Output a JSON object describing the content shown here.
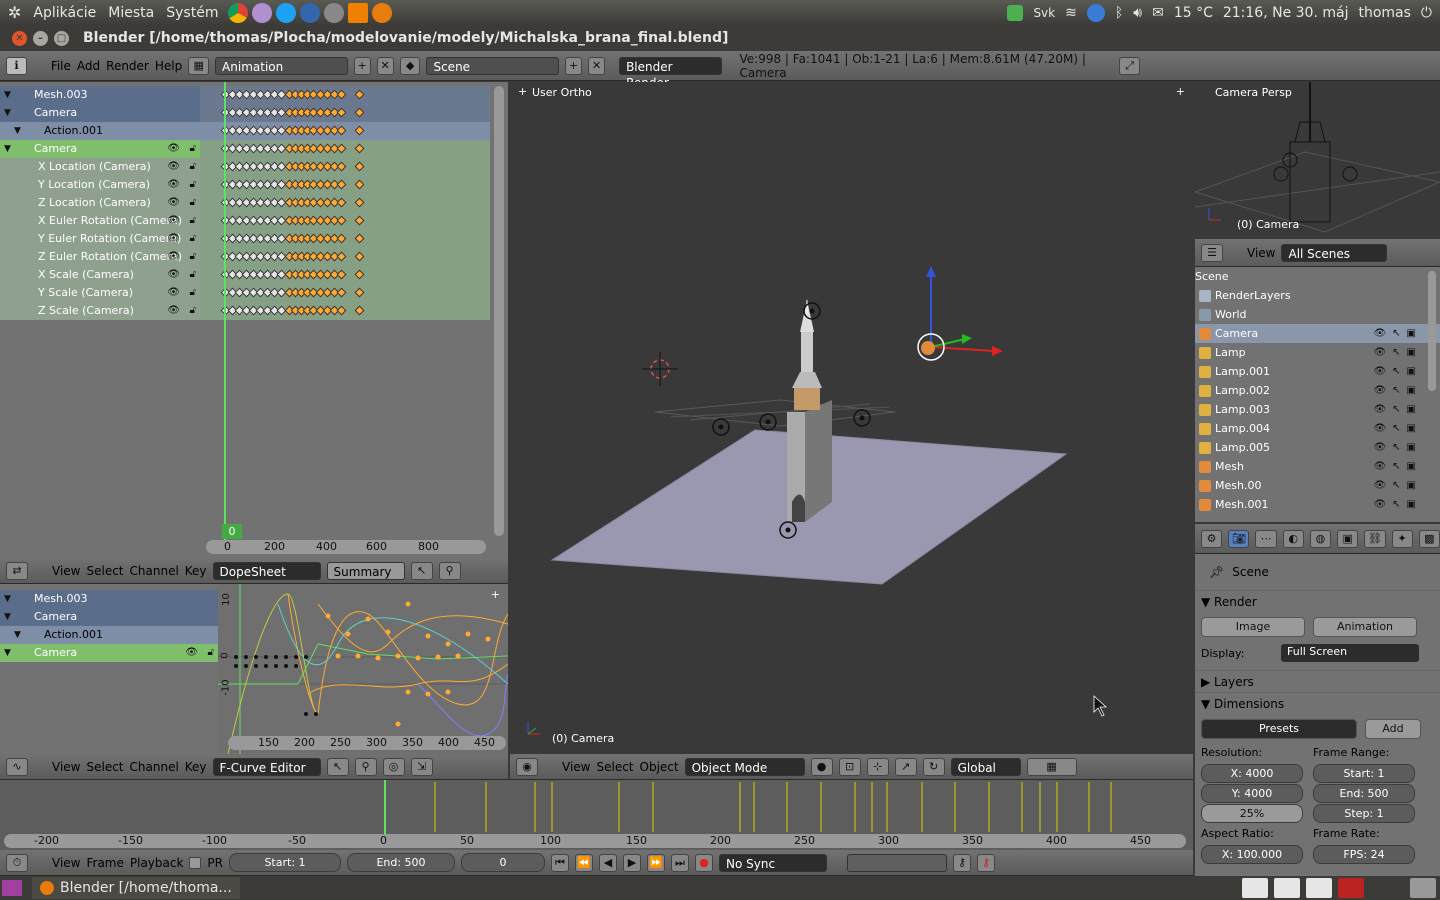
{
  "os_top": {
    "menus": [
      "Aplikácie",
      "Miesta",
      "Systém"
    ],
    "tray": {
      "lang": "Svk",
      "temp": "15 °C",
      "clock": "21:16, Ne 30. máj",
      "user": "thomas"
    }
  },
  "window": {
    "title": "Blender [/home/thomas/Plocha/modelovanie/modely/Michalska_brana_final.blend]"
  },
  "info_header": {
    "menus": [
      "File",
      "Add",
      "Render",
      "Help"
    ],
    "screen": "Animation",
    "scene": "Scene",
    "engine": "Blender Render",
    "stats": "Ve:998 | Fa:1041 | Ob:1-21 | La:6 | Mem:8.61M (47.20M) | Camera"
  },
  "dopesheet": {
    "channels": [
      {
        "label": "Mesh.003",
        "type": "obj"
      },
      {
        "label": "Camera",
        "type": "obj"
      },
      {
        "label": "Action.001",
        "type": "act"
      },
      {
        "label": "Camera",
        "type": "group"
      },
      {
        "label": "X Location (Camera)",
        "type": "ch"
      },
      {
        "label": "Y Location (Camera)",
        "type": "ch"
      },
      {
        "label": "Z Location (Camera)",
        "type": "ch"
      },
      {
        "label": "X Euler Rotation (Camera)",
        "type": "ch"
      },
      {
        "label": "Y Euler Rotation (Camera)",
        "type": "ch"
      },
      {
        "label": "Z Euler Rotation (Camera)",
        "type": "ch"
      },
      {
        "label": "X Scale (Camera)",
        "type": "ch"
      },
      {
        "label": "Y Scale (Camera)",
        "type": "ch"
      },
      {
        "label": "Z Scale (Camera)",
        "type": "ch"
      }
    ],
    "current_frame": "0",
    "ruler": [
      "0",
      "200",
      "400",
      "600",
      "800"
    ],
    "header": {
      "menus": [
        "View",
        "Select",
        "Channel",
        "Key"
      ],
      "mode": "DopeSheet",
      "summary": "Summary"
    }
  },
  "fcurve": {
    "channels": [
      {
        "label": "Mesh.003",
        "type": "obj"
      },
      {
        "label": "Camera",
        "type": "obj"
      },
      {
        "label": "Action.001",
        "type": "act"
      },
      {
        "label": "Camera",
        "type": "group"
      }
    ],
    "y_ticks": [
      "10",
      "0",
      "-10"
    ],
    "ruler": [
      "150",
      "200",
      "250",
      "300",
      "350",
      "400",
      "450"
    ],
    "header": {
      "menus": [
        "View",
        "Select",
        "Channel",
        "Key"
      ],
      "mode": "F-Curve Editor"
    }
  },
  "viewport": {
    "label": "User Ortho",
    "object": "(0) Camera",
    "header": {
      "menus": [
        "View",
        "Select",
        "Object"
      ],
      "mode": "Object Mode",
      "orientation": "Global"
    }
  },
  "camera_view": {
    "label": "Camera Persp",
    "object": "(0) Camera"
  },
  "outliner": {
    "view": "View",
    "scenes": "All Scenes",
    "rows": [
      {
        "label": "Scene",
        "color": "#727272"
      },
      {
        "label": "RenderLayers",
        "color": "#aab4c8"
      },
      {
        "label": "World",
        "color": "#8899aa"
      },
      {
        "label": "Camera",
        "color": "#e08a3a"
      },
      {
        "label": "Lamp",
        "color": "#e0b040"
      },
      {
        "label": "Lamp.001",
        "color": "#e0b040"
      },
      {
        "label": "Lamp.002",
        "color": "#e0b040"
      },
      {
        "label": "Lamp.003",
        "color": "#e0b040"
      },
      {
        "label": "Lamp.004",
        "color": "#e0b040"
      },
      {
        "label": "Lamp.005",
        "color": "#e0b040"
      },
      {
        "label": "Mesh",
        "color": "#e08a3a"
      },
      {
        "label": "Mesh.00",
        "color": "#e08a3a"
      },
      {
        "label": "Mesh.001",
        "color": "#e08a3a"
      }
    ]
  },
  "properties": {
    "context": "Scene",
    "render": {
      "title": "Render",
      "image": "Image",
      "animation": "Animation",
      "display_label": "Display:",
      "display": "Full Screen"
    },
    "layers": "Layers",
    "dimensions": {
      "title": "Dimensions",
      "presets": "Presets",
      "add": "Add",
      "resolution_label": "Resolution:",
      "res_x": "X: 4000",
      "res_y": "Y: 4000",
      "res_pct": "25%",
      "range_label": "Frame Range:",
      "start": "Start: 1",
      "end": "End: 500",
      "step": "Step: 1",
      "aspect_label": "Aspect Ratio:",
      "aspect_x": "X: 100.000",
      "rate_label": "Frame Rate:",
      "fps": "FPS: 24"
    }
  },
  "timeline": {
    "ruler": [
      "-200",
      "-150",
      "-100",
      "-50",
      "0",
      "50",
      "100",
      "150",
      "200",
      "250",
      "300",
      "350",
      "400",
      "450"
    ],
    "header": {
      "menus": [
        "View",
        "Frame",
        "Playback"
      ],
      "pr": "PR",
      "start": "Start: 1",
      "end": "End: 500",
      "current": "0",
      "sync": "No Sync"
    }
  },
  "taskbar": {
    "item": "Blender [/home/thoma..."
  }
}
